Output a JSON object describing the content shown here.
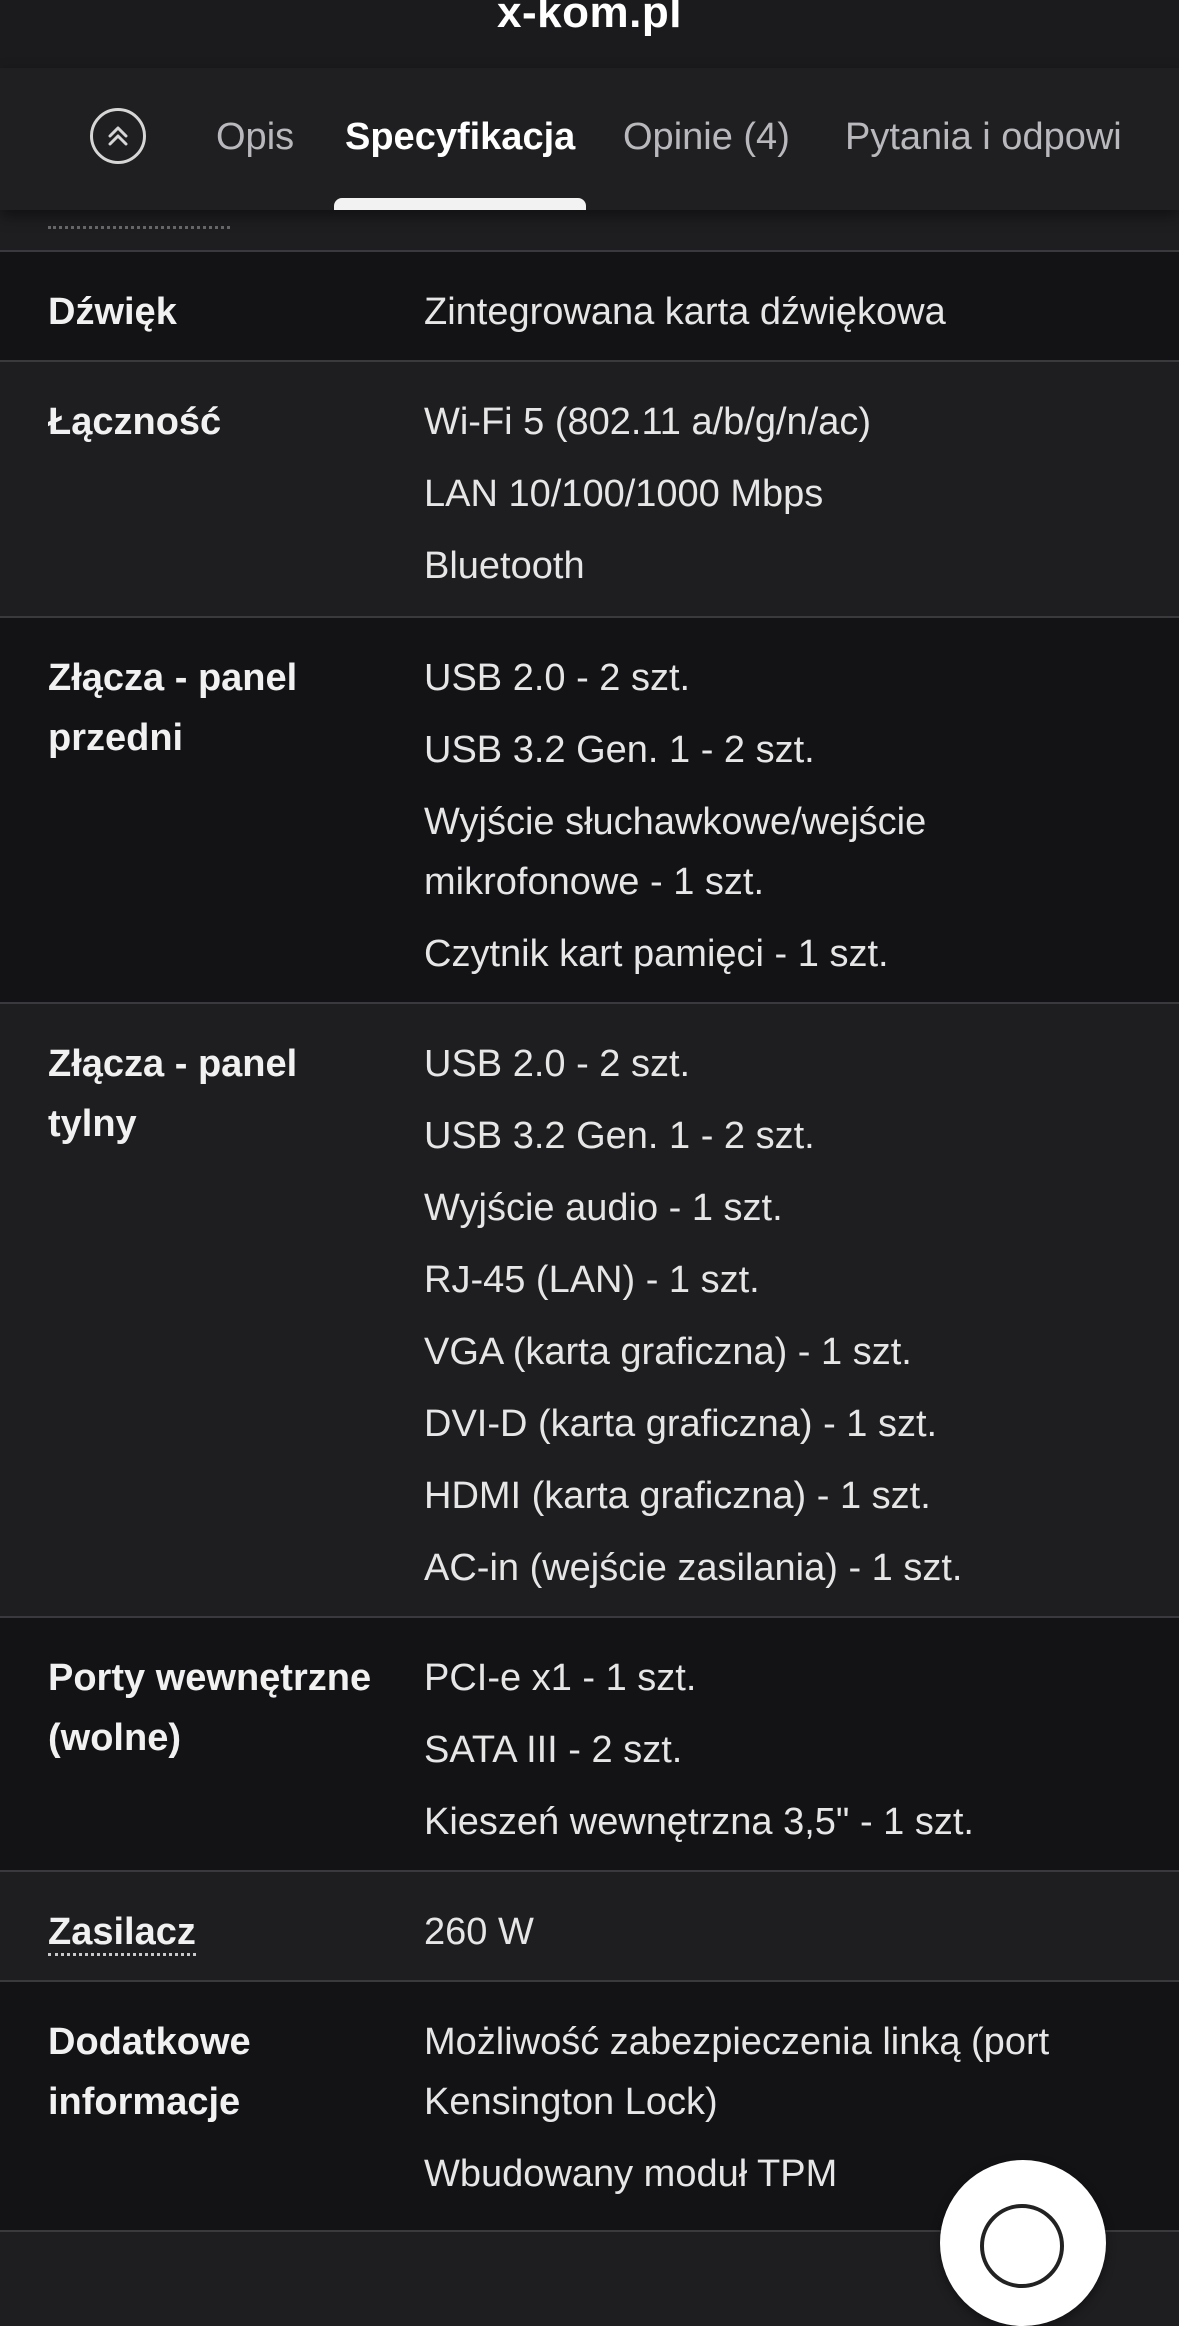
{
  "browser": {
    "url": "x-kom.pl"
  },
  "tabs": [
    {
      "label": "Opis"
    },
    {
      "label": "Specyfikacja"
    },
    {
      "label": "Opinie (4)"
    },
    {
      "label": "Pytania i odpowi"
    }
  ],
  "icons": {
    "scroll_top": "double-chevron-up-icon",
    "fab": "chat-icon"
  },
  "colors": {
    "background": "#1e1e21",
    "row_dark": "#131316",
    "text": "#ececec",
    "accent": "#ffffff"
  },
  "specs": [
    {
      "label": "Dźwięk",
      "values": [
        "Zintegrowana karta dźwiękowa"
      ]
    },
    {
      "label": "Łączność",
      "values": [
        "Wi-Fi 5 (802.11 a/b/g/n/ac)",
        "LAN 10/100/1000 Mbps",
        "Bluetooth"
      ]
    },
    {
      "label": "Złącza - panel przedni",
      "values": [
        "USB 2.0 - 2 szt.",
        "USB 3.2 Gen. 1 - 2 szt.",
        "Wyjście słuchawkowe/wejście mikrofonowe - 1 szt.",
        "Czytnik kart pamięci - 1 szt."
      ]
    },
    {
      "label": "Złącza - panel tylny",
      "values": [
        "USB 2.0 - 2 szt.",
        "USB 3.2 Gen. 1 - 2 szt.",
        "Wyjście audio - 1 szt.",
        "RJ-45 (LAN) - 1 szt.",
        "VGA (karta graficzna) - 1 szt.",
        "DVI-D (karta graficzna) - 1 szt.",
        "HDMI (karta graficzna) - 1 szt.",
        "AC-in (wejście zasilania) - 1 szt."
      ]
    },
    {
      "label": "Porty wewnętrzne (wolne)",
      "values": [
        "PCI-e x1 - 1 szt.",
        "SATA III - 2 szt.",
        "Kieszeń wewnętrzna 3,5\" - 1 szt."
      ]
    },
    {
      "label": "Zasilacz",
      "values": [
        "260 W"
      ]
    },
    {
      "label": "Dodatkowe informacje",
      "values": [
        "Możliwość zabezpieczenia linką (port Kensington Lock)",
        "Wbudowany moduł TPM"
      ]
    }
  ]
}
